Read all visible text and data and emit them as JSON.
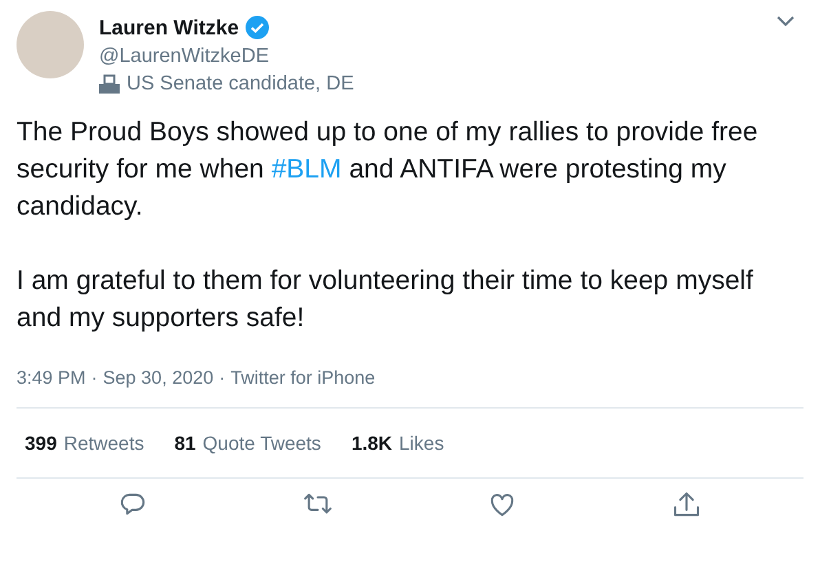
{
  "author": {
    "name": "Lauren Witzke",
    "verified": true,
    "handle": "@LaurenWitzkeDE",
    "label": "US Senate candidate, DE"
  },
  "paragraphs": [
    {
      "parts": [
        {
          "kind": "text",
          "text": "The Proud Boys showed up to one of my rallies to provide free security for me when "
        },
        {
          "kind": "hashtag",
          "text": "#BLM"
        },
        {
          "kind": "text",
          "text": " and ANTIFA were protesting my candidacy."
        }
      ]
    },
    {
      "parts": [
        {
          "kind": "text",
          "text": "I am grateful to them for volunteering their time to keep myself and my supporters safe!"
        }
      ]
    }
  ],
  "timestamp": {
    "time": "3:49 PM",
    "date": "Sep 30, 2020",
    "separator": "·",
    "source": "Twitter for iPhone"
  },
  "stats": [
    {
      "count": "399",
      "label": "Retweets"
    },
    {
      "count": "81",
      "label": "Quote Tweets"
    },
    {
      "count": "1.8K",
      "label": "Likes"
    }
  ],
  "actions": [
    {
      "kind": "reply"
    },
    {
      "kind": "retweet"
    },
    {
      "kind": "like"
    },
    {
      "kind": "share"
    }
  ]
}
